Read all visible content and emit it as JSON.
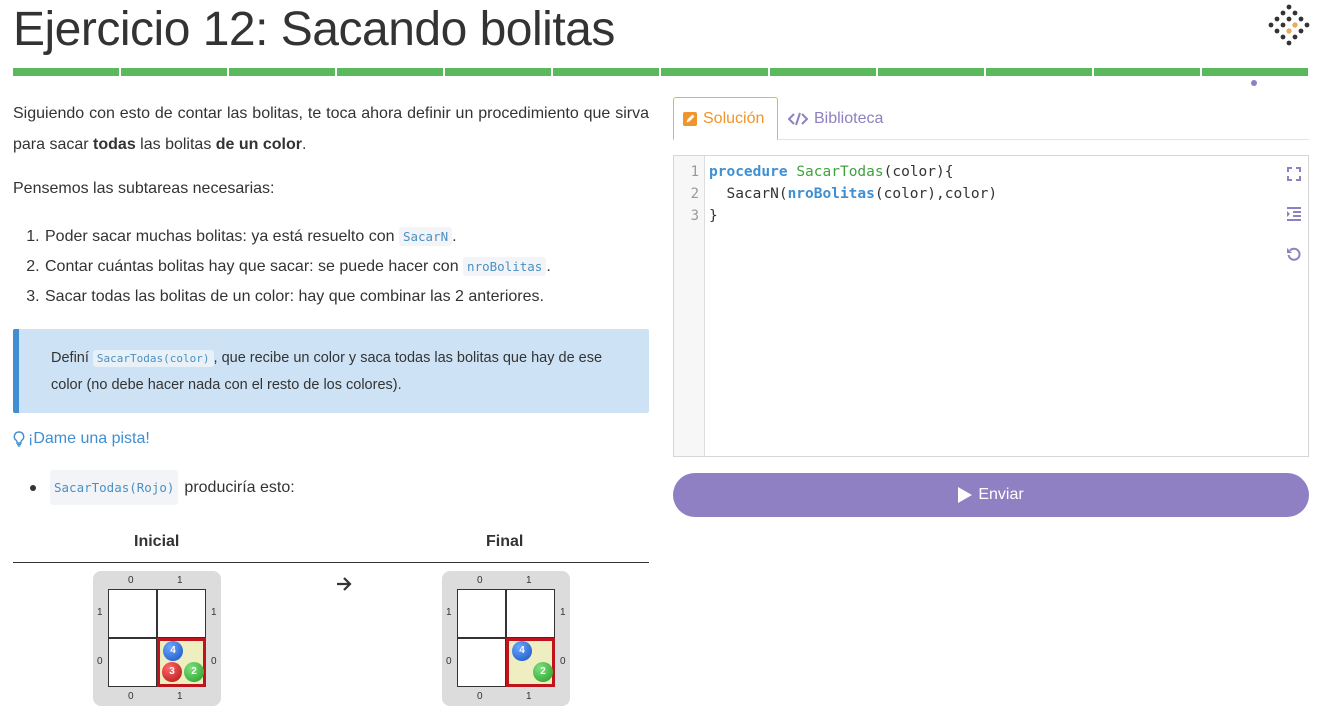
{
  "title": "Ejercicio 12: Sacando bolitas",
  "progress": {
    "segments": 12,
    "color": "#5cb85c",
    "current_index": 12
  },
  "left": {
    "para1": {
      "pre": "Siguiendo con esto de contar las bolitas, te toca ahora definir un procedimiento que sirva para sacar ",
      "b1": "todas",
      "mid": " las bolitas ",
      "b2": "de un color",
      "post": "."
    },
    "para2": "Pensemos las subtareas necesarias:",
    "steps": [
      {
        "text": "Poder sacar muchas bolitas: ya está resuelto con ",
        "code": "SacarN",
        "post": "."
      },
      {
        "text": "Contar cuántas bolitas hay que sacar: se puede hacer con ",
        "code": "nroBolitas",
        "post": "."
      },
      {
        "text": "Sacar todas las bolitas de un color: hay que combinar las 2 anteriores.",
        "code": "",
        "post": ""
      }
    ],
    "callout": {
      "pre": "Definí ",
      "code": "SacarTodas(color)",
      "post": ", que recibe un color y saca todas las bolitas que hay de ese color (no debe hacer nada con el resto de los colores)."
    },
    "hint": "¡Dame una pista!",
    "example": {
      "code": "SacarTodas(Rojo)",
      "text": "produciría esto:"
    },
    "boards": {
      "initial_label": "Inicial",
      "final_label": "Final",
      "cols": [
        "0",
        "1"
      ],
      "rows": [
        "1",
        "0"
      ],
      "initial": {
        "blue": "4",
        "red": "3",
        "green": "2"
      },
      "final": {
        "blue": "4",
        "green": "2"
      }
    }
  },
  "tabs": {
    "solution": "Solución",
    "library": "Biblioteca"
  },
  "editor": {
    "line_numbers": [
      "1",
      "2",
      "3"
    ],
    "line1": {
      "kw": "procedure",
      "name": "SacarTodas",
      "rest": "(color){"
    },
    "line2": {
      "pre": "  SacarN(",
      "fn": "nroBolitas",
      "post": "(color),color)"
    },
    "line3": "}"
  },
  "submit": "Enviar",
  "colors": {
    "accent": "#8e80c2",
    "info": "#3f8fd2",
    "success": "#5cb85c",
    "warning": "#f0952a"
  }
}
